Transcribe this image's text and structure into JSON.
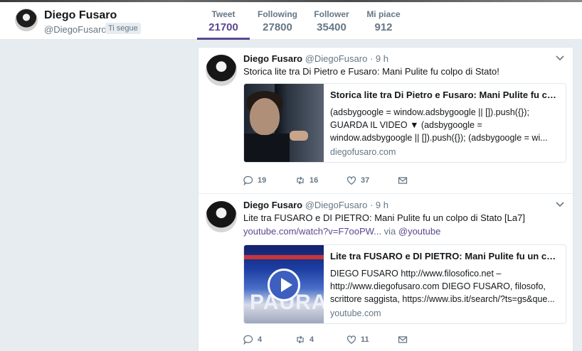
{
  "profile": {
    "name": "Diego Fusaro",
    "handle": "@DiegoFusaro",
    "follows_you": "Ti segue"
  },
  "stats": [
    {
      "label": "Tweet",
      "value": "21700",
      "active": true
    },
    {
      "label": "Following",
      "value": "27800",
      "active": false
    },
    {
      "label": "Follower",
      "value": "35400",
      "active": false
    },
    {
      "label": "Mi piace",
      "value": "912",
      "active": false
    }
  ],
  "colors": {
    "accent": "#5c4690",
    "muted": "#657786",
    "background": "#e6ecf0"
  },
  "tweets": [
    {
      "name": "Diego Fusaro",
      "meta": "@DiegoFusaro · 9 h",
      "text": "Storica lite tra Di Pietro e Fusaro: Mani Pulite fu colpo di Stato!",
      "card": {
        "title": "Storica lite tra Di Pietro e Fusaro: Mani Pulite fu col...",
        "description": "(adsbygoogle = window.adsbygoogle || []).push({}); GUARDA IL VIDEO ▼ (adsbygoogle = window.adsbygoogle || []).push({}); (adsbygoogle = wi...",
        "domain": "diegofusaro.com"
      },
      "replies": "19",
      "retweets": "16",
      "likes": "37"
    },
    {
      "name": "Diego Fusaro",
      "meta": "@DiegoFusaro · 9 h",
      "text": "Lite tra FUSARO e DI PIETRO: Mani Pulite fu un colpo di Stato [La7]",
      "link": "youtube.com/watch?v=F7ooPW...",
      "via": " via ",
      "via_handle": "@youtube",
      "card": {
        "title": "Lite tra FUSARO e DI PIETRO: Mani Pulite fu un col...",
        "description": "DIEGO FUSARO http://www.filosofico.net – http://www.diegofusaro.com DIEGO FUSARO, filosofo, scrittore saggista, https://www.ibs.it/search/?ts=gs&que...",
        "domain": "youtube.com",
        "thumb_text": "PAURA"
      },
      "replies": "4",
      "retweets": "4",
      "likes": "11"
    }
  ]
}
